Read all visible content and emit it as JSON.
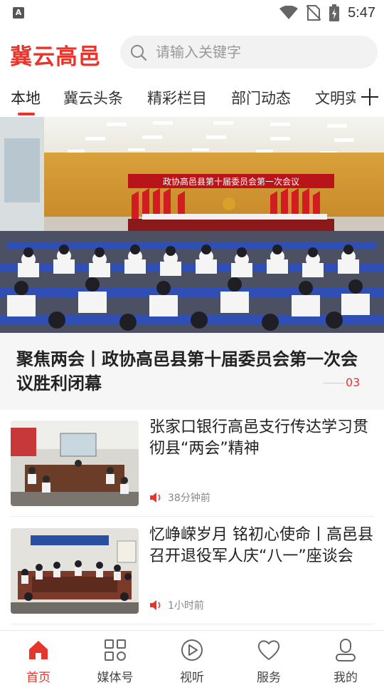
{
  "status_bar": {
    "app_badge": "A",
    "time": "5:47"
  },
  "header": {
    "logo": "冀云高邑",
    "search_placeholder": "请输入关键字"
  },
  "tabs": [
    "本地",
    "冀云头条",
    "精彩栏目",
    "部门动态",
    "文明实践"
  ],
  "banner": {
    "sign_text": "政协高邑县第十届委员会第一次会议",
    "title": "聚焦两会丨政协高邑县第十届委员会第一次会议胜利闭幕",
    "index": "03"
  },
  "news": [
    {
      "title": "张家口银行高邑支行传达学习贯彻县“两会”精神",
      "time": "38分钟前"
    },
    {
      "title": "忆峥嵘岁月 铭初心使命丨高邑县召开退役军人庆“八一”座谈会",
      "time": "1小时前"
    }
  ],
  "bottom_nav": [
    {
      "label": "首页",
      "icon": "home-icon"
    },
    {
      "label": "媒体号",
      "icon": "grid-icon"
    },
    {
      "label": "视听",
      "icon": "play-icon"
    },
    {
      "label": "服务",
      "icon": "heart-icon"
    },
    {
      "label": "我的",
      "icon": "user-icon"
    }
  ],
  "colors": {
    "accent": "#e8352c"
  }
}
